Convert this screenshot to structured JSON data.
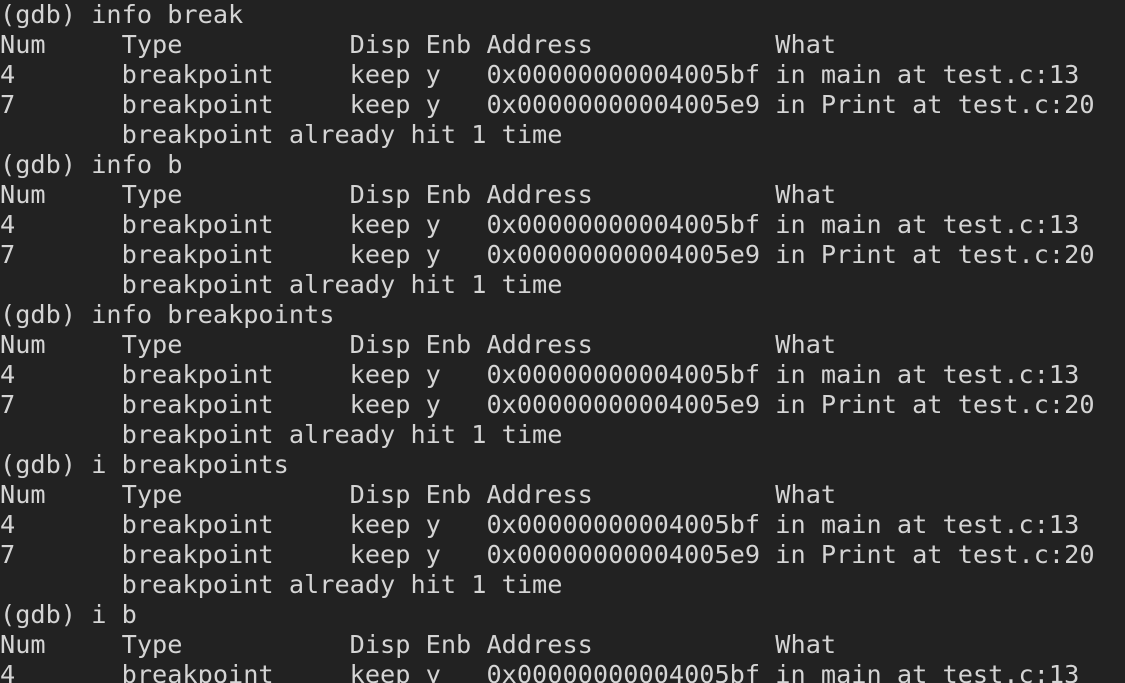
{
  "terminal": {
    "program": "gdb",
    "prompt": "(gdb) ",
    "background_color": "#222222",
    "text_color": "#d4d4d4",
    "font_size_px": 22,
    "line_height_px": 30,
    "columns": 74,
    "rows": 23,
    "table_header": "Num     Type           Disp Enb Address            What",
    "columns_labels": [
      "Num",
      "Type",
      "Disp",
      "Enb",
      "Address",
      "What"
    ],
    "breakpoints": [
      {
        "num": "4",
        "type": "breakpoint",
        "disp": "keep",
        "enb": "y",
        "address": "0x00000000004005bf",
        "what": "in main at test.c:13"
      },
      {
        "num": "7",
        "type": "breakpoint",
        "disp": "keep",
        "enb": "y",
        "address": "0x00000000004005e9",
        "what": "in Print at test.c:20"
      }
    ],
    "hit_note": "        breakpoint already hit 1 time",
    "commands": [
      "info break",
      "info b",
      "info breakpoints",
      "i breakpoints",
      "i b"
    ],
    "lines": [
      "(gdb) info break",
      "Num     Type           Disp Enb Address            What",
      "4       breakpoint     keep y   0x00000000004005bf in main at test.c:13",
      "7       breakpoint     keep y   0x00000000004005e9 in Print at test.c:20",
      "        breakpoint already hit 1 time",
      "(gdb) info b",
      "Num     Type           Disp Enb Address            What",
      "4       breakpoint     keep y   0x00000000004005bf in main at test.c:13",
      "7       breakpoint     keep y   0x00000000004005e9 in Print at test.c:20",
      "        breakpoint already hit 1 time",
      "(gdb) info breakpoints",
      "Num     Type           Disp Enb Address            What",
      "4       breakpoint     keep y   0x00000000004005bf in main at test.c:13",
      "7       breakpoint     keep y   0x00000000004005e9 in Print at test.c:20",
      "        breakpoint already hit 1 time",
      "(gdb) i breakpoints",
      "Num     Type           Disp Enb Address            What",
      "4       breakpoint     keep y   0x00000000004005bf in main at test.c:13",
      "7       breakpoint     keep y   0x00000000004005e9 in Print at test.c:20",
      "        breakpoint already hit 1 time",
      "(gdb) i b",
      "Num     Type           Disp Enb Address            What",
      "4       breakpoint     keep y   0x00000000004005bf in main at test.c:13"
    ]
  }
}
